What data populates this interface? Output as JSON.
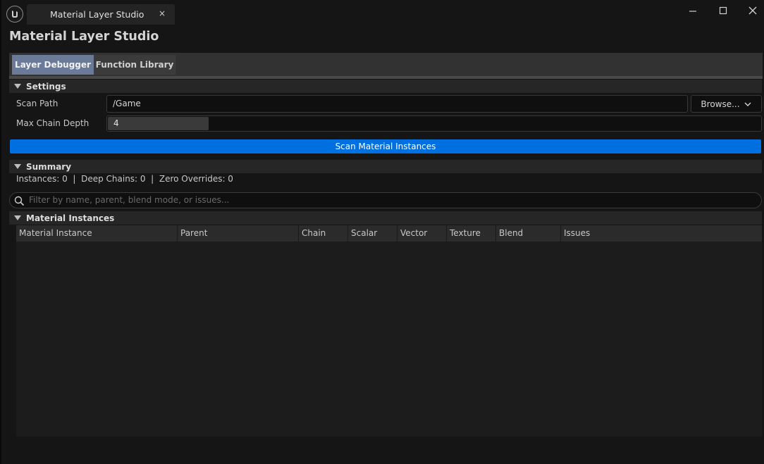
{
  "window": {
    "tab_title": "Material Layer Studio",
    "tab_close": "×"
  },
  "header": {
    "title": "Material Layer Studio"
  },
  "tabs": [
    {
      "label": "Layer Debugger",
      "active": true
    },
    {
      "label": "Function Library",
      "active": false
    }
  ],
  "settings": {
    "section_label": "Settings",
    "scan_path_label": "Scan Path",
    "scan_path_value": "/Game",
    "browse_label": "Browse...",
    "max_depth_label": "Max Chain Depth",
    "max_depth_value": "4",
    "scan_button_label": "Scan Material Instances"
  },
  "summary": {
    "section_label": "Summary",
    "text": "Instances: 0  |  Deep Chains: 0  |  Zero Overrides: 0"
  },
  "filter": {
    "placeholder": "Filter by name, parent, blend mode, or issues..."
  },
  "table": {
    "section_label": "Material Instances",
    "columns": [
      "Material Instance",
      "Parent",
      "Chain",
      "Scalar",
      "Vector",
      "Texture",
      "Blend",
      "Issues"
    ],
    "rows": []
  },
  "colors": {
    "accent": "#0070e0",
    "active_tab": "#6a7a98",
    "background": "#151515"
  }
}
